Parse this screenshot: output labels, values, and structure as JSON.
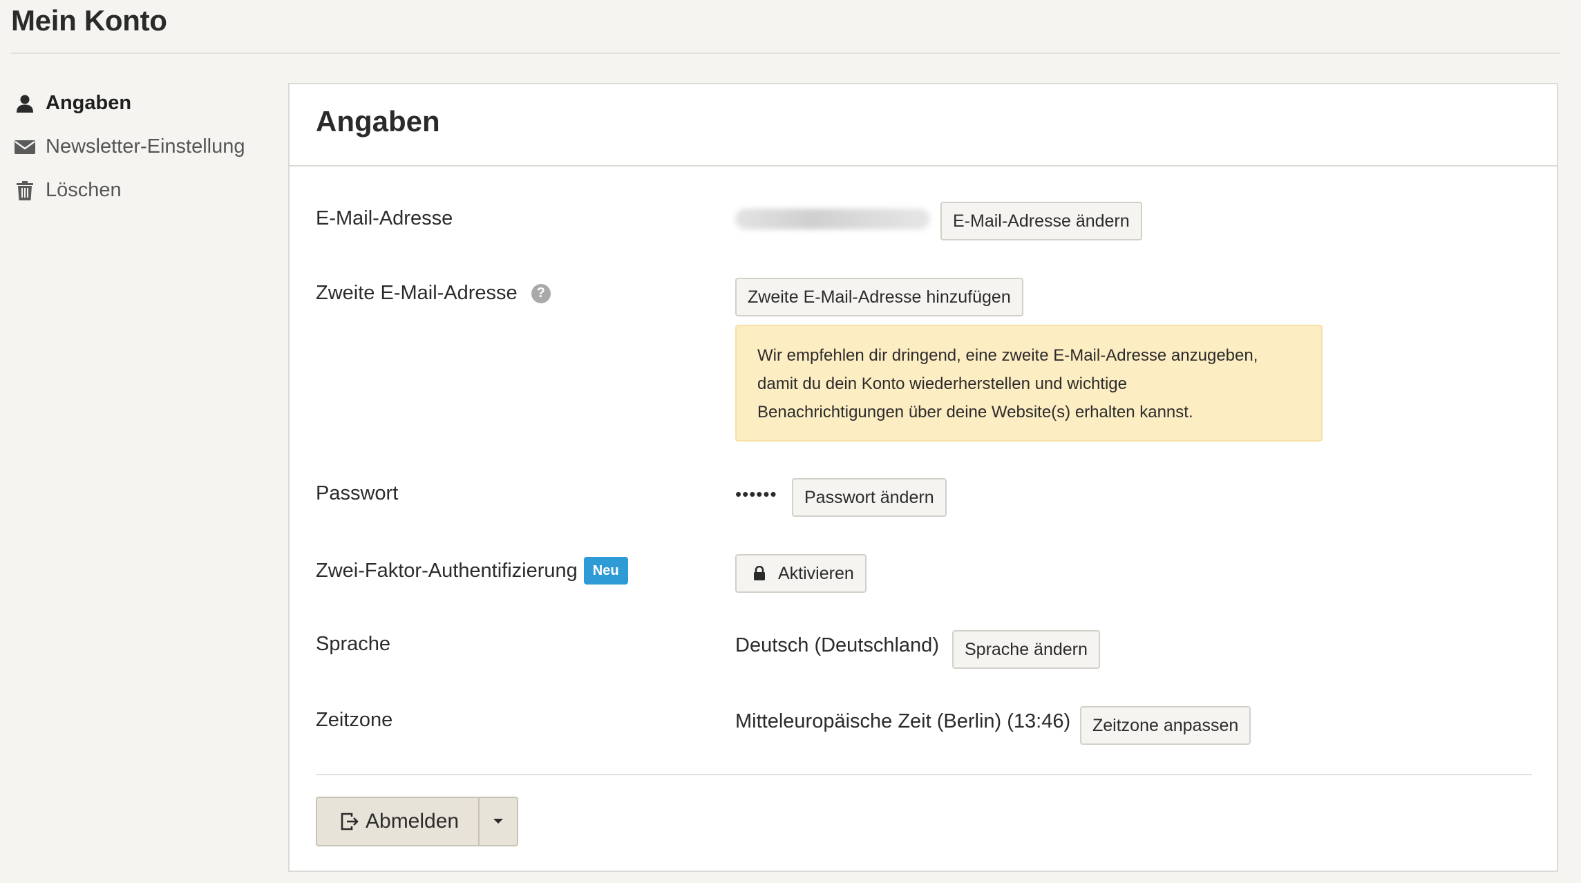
{
  "header": {
    "title": "Mein Konto"
  },
  "sidebar": {
    "items": [
      {
        "label": "Angaben",
        "icon": "user-icon",
        "active": true
      },
      {
        "label": "Newsletter-Einstellung",
        "icon": "envelope-icon",
        "active": false
      },
      {
        "label": "Löschen",
        "icon": "trash-icon",
        "active": false
      }
    ]
  },
  "main": {
    "title": "Angaben",
    "email": {
      "label": "E-Mail-Adresse",
      "value_redacted": true,
      "button": "E-Mail-Adresse ändern"
    },
    "second_email": {
      "label": "Zweite E-Mail-Adresse",
      "help_icon": "?",
      "button": "Zweite E-Mail-Adresse hinzufügen",
      "notice_lines": [
        "Wir empfehlen dir dringend, eine zweite E-Mail-Adresse anzugeben,",
        "damit du dein Konto wiederherstellen und wichtige",
        "Benachrichtigungen über deine Website(s) erhalten kannst."
      ]
    },
    "password": {
      "label": "Passwort",
      "value": "••••••",
      "button": "Passwort ändern"
    },
    "two_factor": {
      "label": "Zwei-Faktor-Authentifizierung",
      "badge": "Neu",
      "button": "Aktivieren"
    },
    "language": {
      "label": "Sprache",
      "value": "Deutsch (Deutschland)",
      "button": "Sprache ändern"
    },
    "timezone": {
      "label": "Zeitzone",
      "value": "Mitteleuropäische Zeit (Berlin) (13:46)",
      "button": "Zeitzone anpassen"
    },
    "logout": {
      "label": "Abmelden"
    }
  },
  "colors": {
    "background": "#f5f4f0",
    "badge": "#2f9bd6",
    "notice": "#fdedc3"
  }
}
